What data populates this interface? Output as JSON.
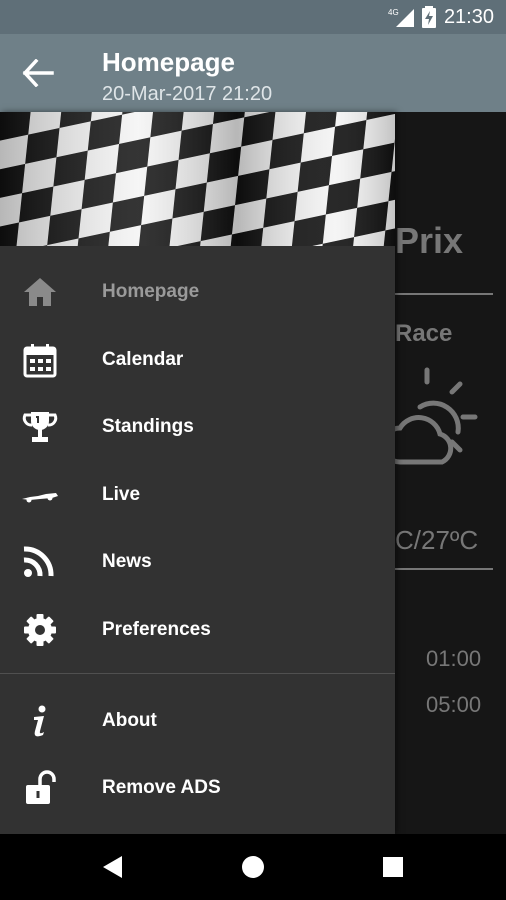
{
  "status_bar": {
    "network": "4G",
    "time": "21:30"
  },
  "app_bar": {
    "title": "Homepage",
    "subtitle": "20-Mar-2017 21:20"
  },
  "background": {
    "title_fragment": "Prix",
    "session_fragment": "Race",
    "temperature_fragment": "C/27ºC",
    "times": [
      "01:00",
      "05:00"
    ]
  },
  "drawer": {
    "items": [
      {
        "label": "Homepage",
        "icon": "home-icon",
        "active": true
      },
      {
        "label": "Calendar",
        "icon": "calendar-icon"
      },
      {
        "label": "Standings",
        "icon": "trophy-icon"
      },
      {
        "label": "Live",
        "icon": "race-car-icon"
      },
      {
        "label": "News",
        "icon": "rss-icon"
      },
      {
        "label": "Preferences",
        "icon": "gear-icon"
      }
    ],
    "secondary_items": [
      {
        "label": "About",
        "icon": "info-icon"
      },
      {
        "label": "Remove ADS",
        "icon": "unlock-icon"
      }
    ]
  },
  "colors": {
    "app_bar": "#6f8088",
    "status_bar": "#5f6f78",
    "drawer_bg": "#323232"
  }
}
